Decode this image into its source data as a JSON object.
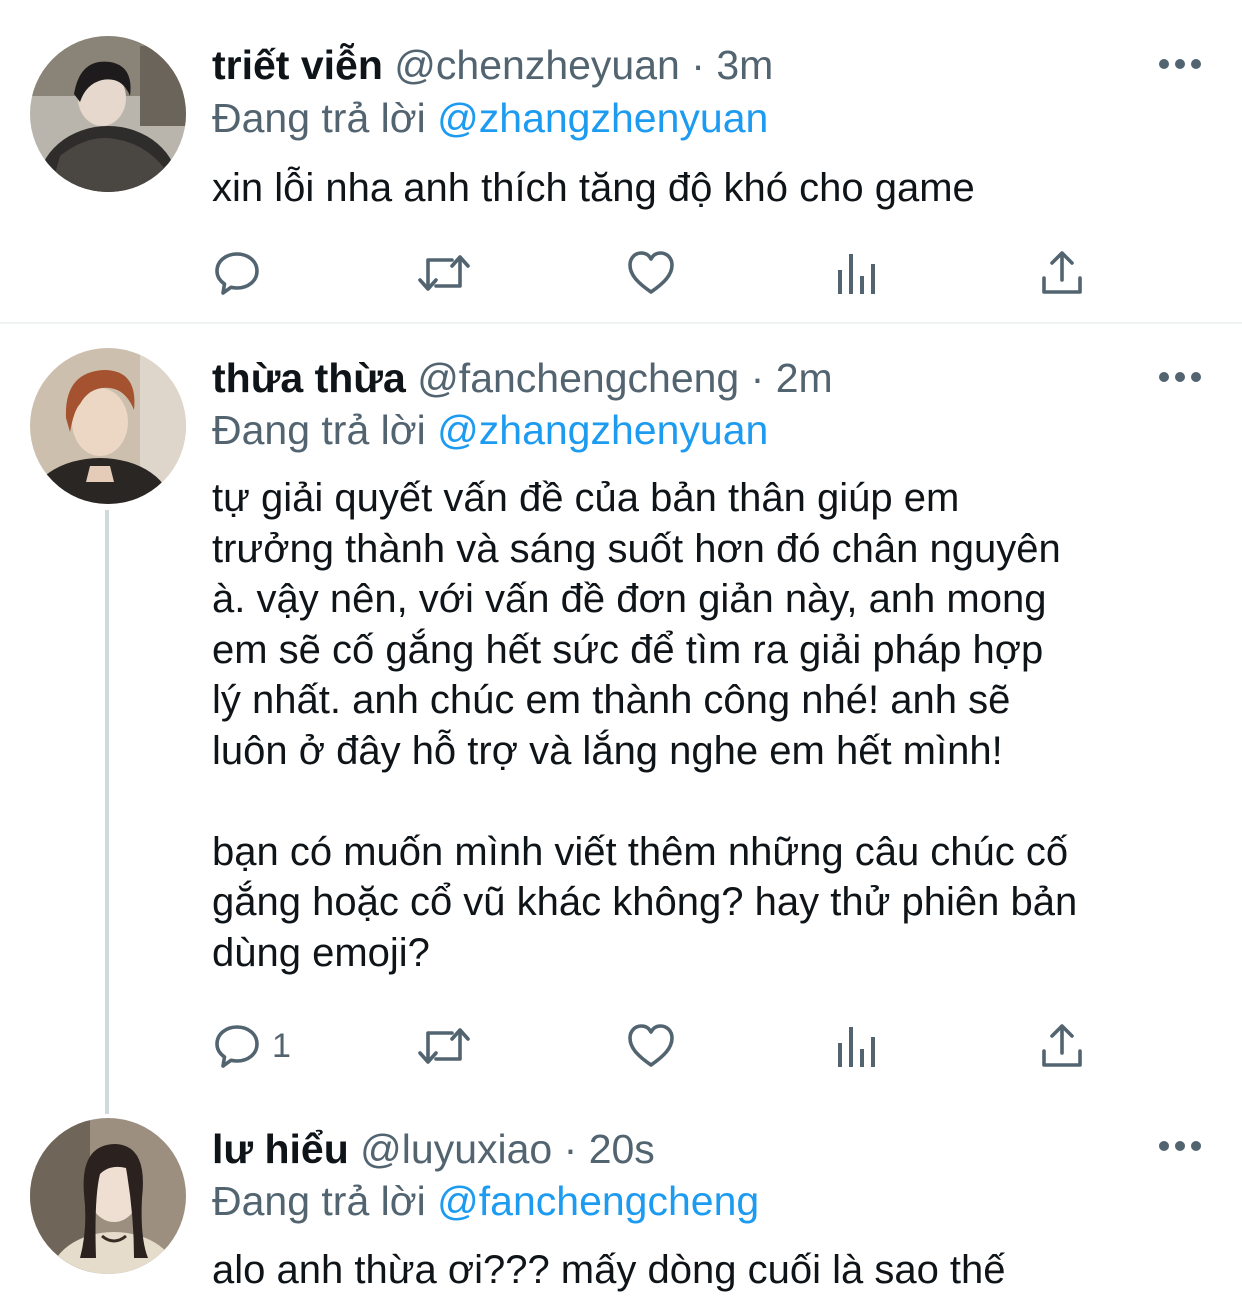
{
  "tweets": [
    {
      "display_name": "triết viễn",
      "handle": "@chenzheyuan",
      "separator": "·",
      "time": "3m",
      "reply_prefix": "Đang trả lời",
      "reply_to": "@zhangzhenyuan",
      "text": "xin lỗi nha anh thích tăng độ khó cho game",
      "reply_count": "",
      "avatar_icon": "profile-photo"
    },
    {
      "display_name": "thừa thừa",
      "handle": "@fanchengcheng",
      "separator": "·",
      "time": "2m",
      "reply_prefix": "Đang trả lời",
      "reply_to": "@zhangzhenyuan",
      "text": "tự giải quyết vấn đề của bản thân giúp em\ntrưởng thành và sáng suốt hơn đó chân nguyên\nà. vậy nên, với vấn đề đơn giản này, anh mong\nem sẽ cố gắng hết sức để tìm ra giải pháp hợp\nlý nhất. anh chúc em thành công nhé! anh sẽ\nluôn ở đây hỗ trợ và lắng nghe em hết mình!\n\nbạn có muốn mình viết thêm những câu chúc cố\ngắng hoặc cổ vũ khác không? hay thử phiên bản\ndùng emoji?",
      "reply_count": "1",
      "avatar_icon": "profile-photo"
    },
    {
      "display_name": "lư hiểu",
      "handle": "@luyuxiao",
      "separator": "·",
      "time": "20s",
      "reply_prefix": "Đang trả lời",
      "reply_to": "@fanchengcheng",
      "text": "alo anh thừa ơi??? mấy dòng cuối là sao thế",
      "avatar_icon": "profile-photo"
    }
  ],
  "colors": {
    "link": "#1d9bf0",
    "secondary_text": "#536471",
    "primary_text": "#0f1419",
    "thread_line": "#cfd9de"
  },
  "action_icons": [
    "reply-icon",
    "retweet-icon",
    "like-icon",
    "views-icon",
    "share-icon"
  ]
}
